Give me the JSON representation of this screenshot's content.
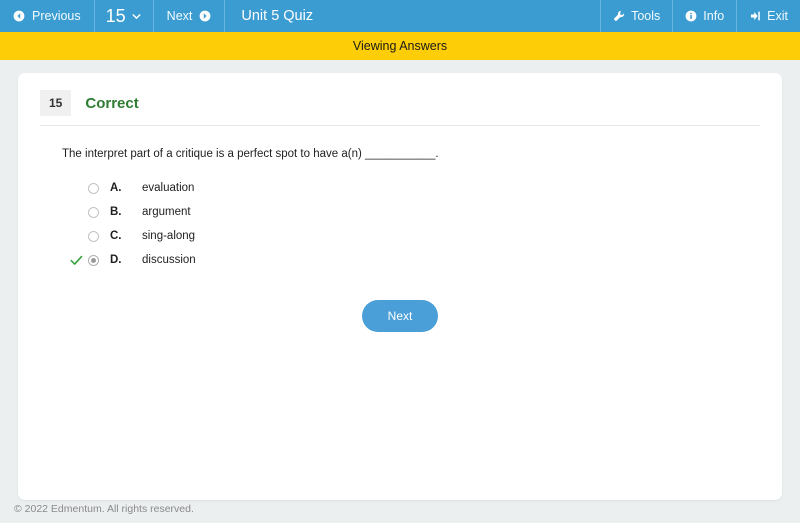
{
  "topbar": {
    "previous_label": "Previous",
    "previous_icon": "arrow-circle-left-icon",
    "page_number": "15",
    "page_caret_icon": "chevron-down-icon",
    "next_label": "Next",
    "next_icon": "arrow-circle-right-icon",
    "title": "Unit 5 Quiz",
    "tools_label": "Tools",
    "tools_icon": "wrench-icon",
    "info_label": "Info",
    "info_icon": "info-circle-icon",
    "exit_label": "Exit",
    "exit_icon": "sign-out-icon",
    "background_color": "#3b9cd2"
  },
  "banner": {
    "text": "Viewing Answers",
    "background_color": "#fdcd07"
  },
  "question": {
    "number": "15",
    "status": "Correct",
    "status_color": "#2f7d32",
    "text": "The interpret part of a critique is a perfect spot to have a(n) ___________.",
    "choices": [
      {
        "letter": "A.",
        "text": "evaluation",
        "selected": false,
        "correct_mark": false
      },
      {
        "letter": "B.",
        "text": "argument",
        "selected": false,
        "correct_mark": false
      },
      {
        "letter": "C.",
        "text": "sing-along",
        "selected": false,
        "correct_mark": false
      },
      {
        "letter": "D.",
        "text": "discussion",
        "selected": true,
        "correct_mark": true
      }
    ]
  },
  "actions": {
    "next_label": "Next",
    "next_color": "#4a9fd8"
  },
  "footer": {
    "copyright": "© 2022 Edmentum. All rights reserved."
  }
}
